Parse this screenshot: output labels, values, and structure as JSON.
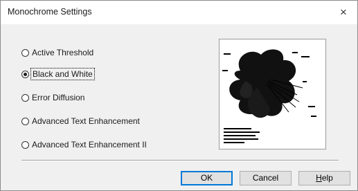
{
  "window": {
    "title": "Monochrome Settings",
    "close_glyph": "×"
  },
  "options": [
    {
      "label": "Active Threshold",
      "checked": false
    },
    {
      "label": "Black and White",
      "checked": true
    },
    {
      "label": "Error Diffusion",
      "checked": false
    },
    {
      "label": "Advanced Text Enhancement",
      "checked": false
    },
    {
      "label": "Advanced Text Enhancement II",
      "checked": false
    }
  ],
  "preview": {
    "icon": "flower-sample-image"
  },
  "buttons": {
    "ok": "OK",
    "cancel": "Cancel",
    "help_first": "H",
    "help_rest": "elp"
  },
  "colors": {
    "focus": "#0078d7",
    "dialog_bg": "#f0f0f0"
  }
}
